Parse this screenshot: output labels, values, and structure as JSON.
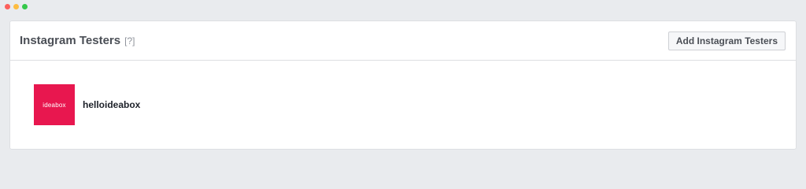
{
  "window": {
    "controls": [
      "close",
      "minimize",
      "maximize"
    ]
  },
  "header": {
    "title": "Instagram Testers",
    "help": "[?]",
    "add_button_label": "Add Instagram Testers"
  },
  "testers": [
    {
      "avatar_text": "ideabox",
      "username": "helloideabox",
      "avatar_color": "#e8174f"
    }
  ]
}
